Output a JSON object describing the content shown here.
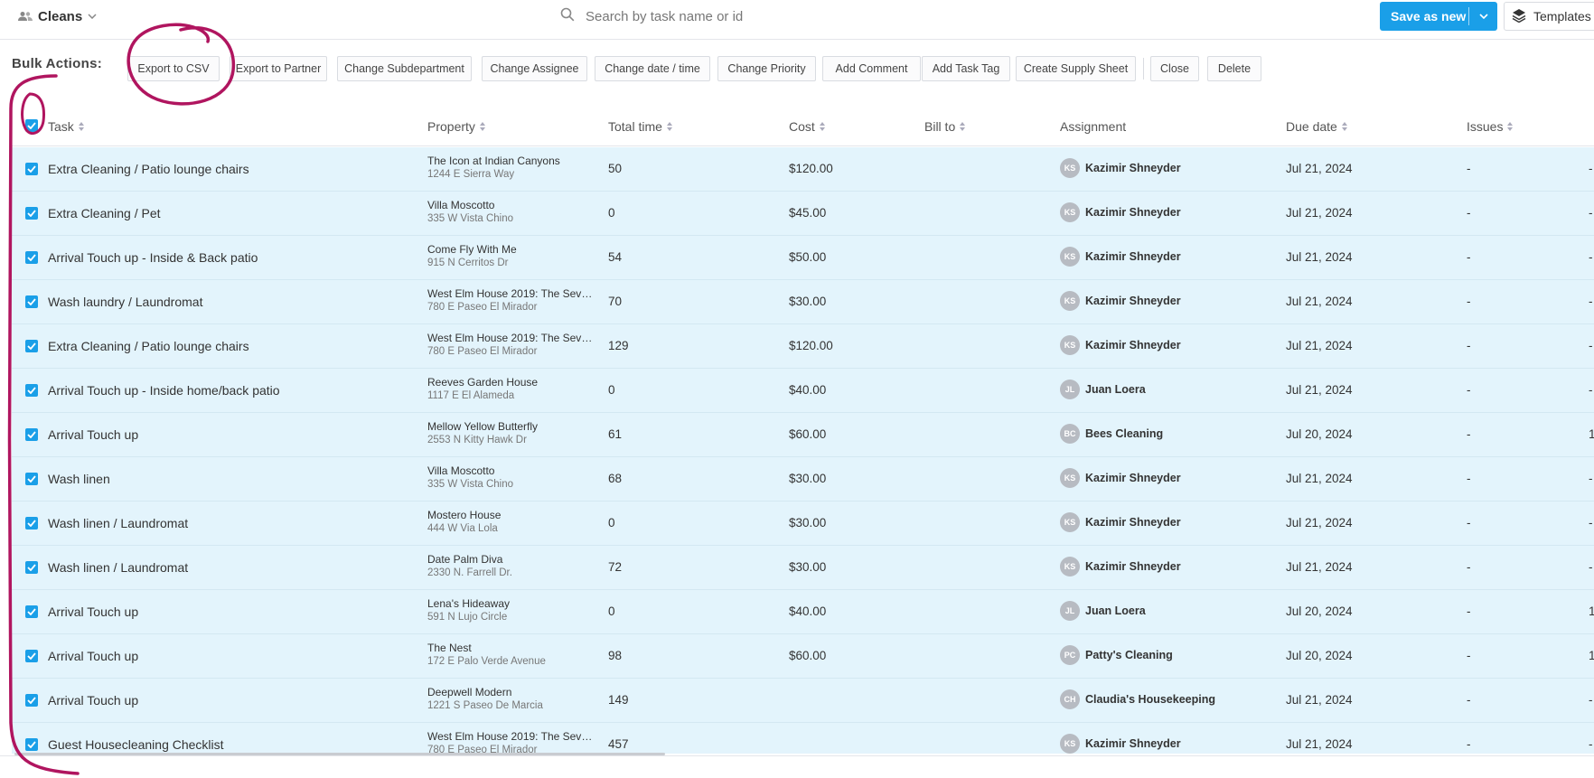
{
  "header": {
    "view_name": "Cleans",
    "search_placeholder": "Search by task name or id",
    "save_label": "Save as new",
    "templates_label": "Templates"
  },
  "bulk": {
    "label": "Bulk Actions:",
    "actions": [
      "Export to CSV",
      "Export to Partner",
      "Change Subdepartment",
      "Change Assignee",
      "Change date / time",
      "Change Priority",
      "Add Comment",
      "Add Task Tag",
      "Create Supply Sheet",
      "Close",
      "Delete"
    ]
  },
  "columns": {
    "task": "Task",
    "property": "Property",
    "total_time": "Total time",
    "cost": "Cost",
    "bill_to": "Bill to",
    "assignment": "Assignment",
    "due_date": "Due date",
    "issues": "Issues"
  },
  "rows": [
    {
      "task": "Extra Cleaning / Patio lounge chairs",
      "property": "The Icon at Indian Canyons",
      "address": "1244 E Sierra Way",
      "time": "50",
      "cost": "$120.00",
      "initials": "KS",
      "assignee": "Kazimir Shneyder",
      "due": "Jul 21, 2024",
      "issues": "-",
      "extra": "-"
    },
    {
      "task": "Extra Cleaning / Pet",
      "property": "Villa Moscotto",
      "address": "335 W Vista Chino",
      "time": "0",
      "cost": "$45.00",
      "initials": "KS",
      "assignee": "Kazimir Shneyder",
      "due": "Jul 21, 2024",
      "issues": "-",
      "extra": "-"
    },
    {
      "task": "Arrival Touch up - Inside & Back patio",
      "property": "Come Fly With Me",
      "address": "915 N Cerritos Dr",
      "time": "54",
      "cost": "$50.00",
      "initials": "KS",
      "assignee": "Kazimir Shneyder",
      "due": "Jul 21, 2024",
      "issues": "-",
      "extra": "-"
    },
    {
      "task": "Wash laundry / Laundromat",
      "property": "West Elm House 2019: The Seven...",
      "address": "780 E Paseo El Mirador",
      "time": "70",
      "cost": "$30.00",
      "initials": "KS",
      "assignee": "Kazimir Shneyder",
      "due": "Jul 21, 2024",
      "issues": "-",
      "extra": "-"
    },
    {
      "task": "Extra Cleaning / Patio lounge chairs",
      "property": "West Elm House 2019: The Seven...",
      "address": "780 E Paseo El Mirador",
      "time": "129",
      "cost": "$120.00",
      "initials": "KS",
      "assignee": "Kazimir Shneyder",
      "due": "Jul 21, 2024",
      "issues": "-",
      "extra": "-"
    },
    {
      "task": "Arrival Touch up - Inside home/back patio",
      "property": "Reeves Garden House",
      "address": "1117 E El Alameda",
      "time": "0",
      "cost": "$40.00",
      "initials": "JL",
      "assignee": "Juan Loera",
      "due": "Jul 21, 2024",
      "issues": "-",
      "extra": "-"
    },
    {
      "task": "Arrival Touch up",
      "property": "Mellow Yellow Butterfly",
      "address": "2553 N Kitty Hawk Dr",
      "time": "61",
      "cost": "$60.00",
      "initials": "BC",
      "assignee": "Bees Cleaning",
      "due": "Jul 20, 2024",
      "issues": "-",
      "extra": "1"
    },
    {
      "task": "Wash linen",
      "property": "Villa Moscotto",
      "address": "335 W Vista Chino",
      "time": "68",
      "cost": "$30.00",
      "initials": "KS",
      "assignee": "Kazimir Shneyder",
      "due": "Jul 21, 2024",
      "issues": "-",
      "extra": "-"
    },
    {
      "task": "Wash linen / Laundromat",
      "property": "Mostero House",
      "address": "444 W Via Lola",
      "time": "0",
      "cost": "$30.00",
      "initials": "KS",
      "assignee": "Kazimir Shneyder",
      "due": "Jul 21, 2024",
      "issues": "-",
      "extra": "-"
    },
    {
      "task": "Wash linen / Laundromat",
      "property": "Date Palm Diva",
      "address": "2330 N. Farrell Dr.",
      "time": "72",
      "cost": "$30.00",
      "initials": "KS",
      "assignee": "Kazimir Shneyder",
      "due": "Jul 21, 2024",
      "issues": "-",
      "extra": "-"
    },
    {
      "task": "Arrival Touch up",
      "property": "Lena's Hideaway",
      "address": "591 N Lujo Circle",
      "time": "0",
      "cost": "$40.00",
      "initials": "JL",
      "assignee": "Juan Loera",
      "due": "Jul 20, 2024",
      "issues": "-",
      "extra": "1"
    },
    {
      "task": "Arrival Touch up",
      "property": "The Nest",
      "address": "172 E Palo Verde Avenue",
      "time": "98",
      "cost": "$60.00",
      "initials": "PC",
      "assignee": "Patty's Cleaning",
      "due": "Jul 20, 2024",
      "issues": "-",
      "extra": "1"
    },
    {
      "task": "Arrival Touch up",
      "property": "Deepwell Modern",
      "address": "1221 S Paseo De Marcia",
      "time": "149",
      "cost": "",
      "initials": "CH",
      "assignee": "Claudia's Housekeeping",
      "due": "Jul 21, 2024",
      "issues": "-",
      "extra": "-"
    },
    {
      "task": "Guest Housecleaning Checklist",
      "property": "West Elm House 2019: The Seven...",
      "address": "780 E Paseo El Mirador",
      "time": "457",
      "cost": "",
      "initials": "KS",
      "assignee": "Kazimir Shneyder",
      "due": "Jul 21, 2024",
      "issues": "-",
      "extra": "-"
    }
  ],
  "colors": {
    "accent": "#1a9fe8",
    "row_selected": "#e3f4fc",
    "annotation": "#b0155f"
  }
}
